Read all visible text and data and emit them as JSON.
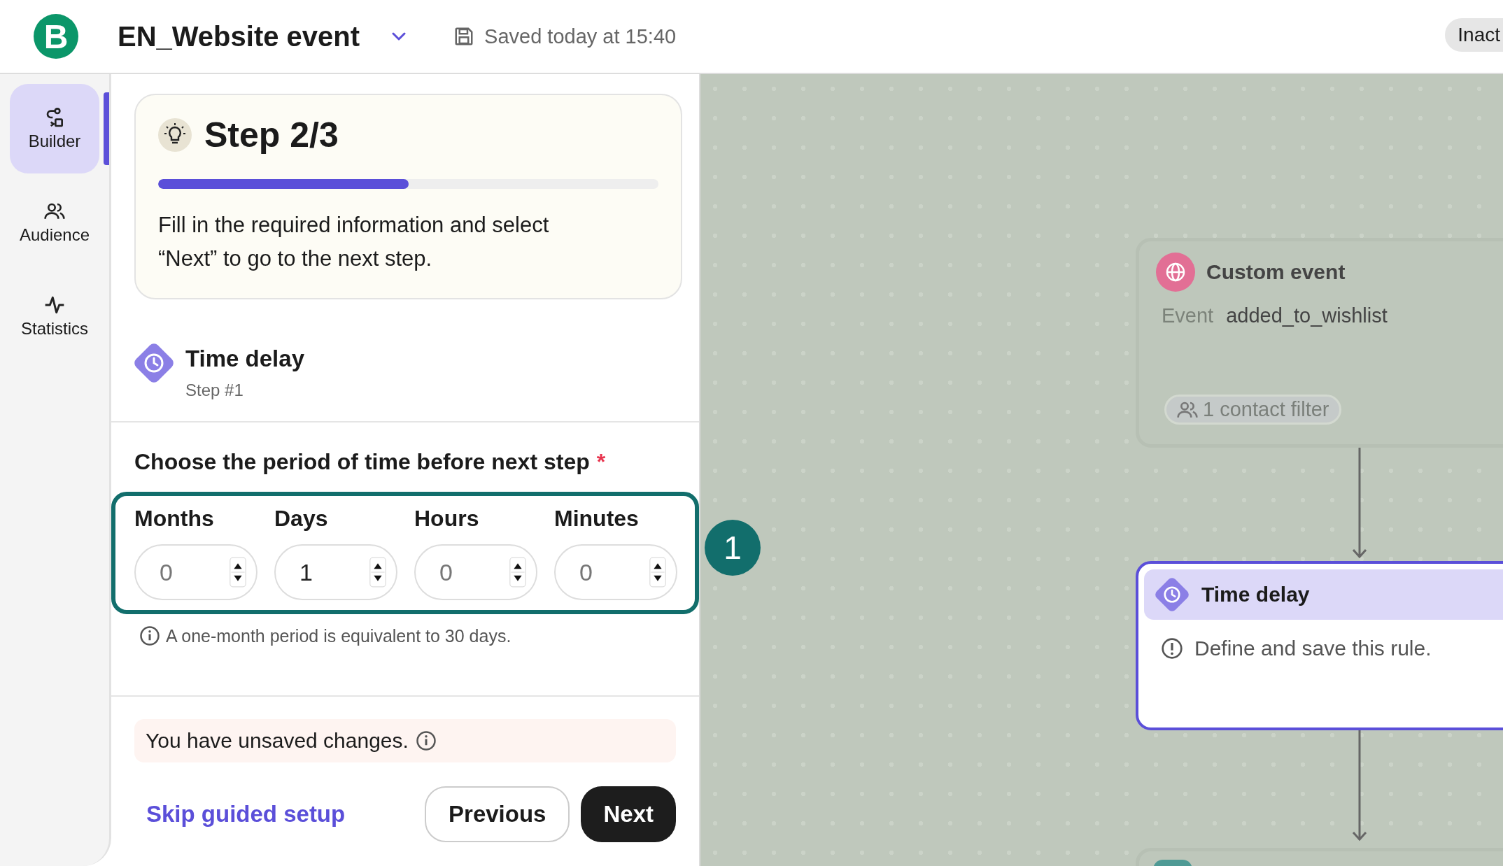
{
  "header": {
    "logo_letter": "B",
    "title": "EN_Website event",
    "save_status": "Saved today at 15:40",
    "status_badge": "Inact"
  },
  "nav": [
    {
      "label": "Builder",
      "selected": true
    },
    {
      "label": "Audience",
      "selected": false
    },
    {
      "label": "Statistics",
      "selected": false
    }
  ],
  "guide": {
    "title": "Step 2/3",
    "level": 0.5,
    "text": "Fill in the required information and select “Next” to go to the next step."
  },
  "step": {
    "title": "Time delay",
    "subtitle": "Step #1"
  },
  "period": {
    "label": "Choose the period of time before next step",
    "required": true,
    "required_mark": "*",
    "fields": [
      {
        "label": "Months",
        "placeholder": "0"
      },
      {
        "label": "Days",
        "value": "1"
      },
      {
        "label": "Hours",
        "placeholder": "0"
      },
      {
        "label": "Minutes",
        "placeholder": "0"
      }
    ],
    "hint": "A one-month period is equivalent to 30 days.",
    "callout": "1"
  },
  "unsaved": "You have unsaved changes.",
  "actions": {
    "skip": "Skip guided setup",
    "previous": "Previous",
    "next": "Next"
  },
  "canvas": {
    "nodes": [
      {
        "kind": "trigger",
        "selected": false,
        "title": "Custom event",
        "field_label": "Event",
        "field_value": "added_to_wishlist",
        "filter": "1 contact filter"
      },
      {
        "kind": "delay",
        "selected": true,
        "title": "Time delay",
        "warning": "Define and save this rule."
      },
      {
        "kind": "partial",
        "selected": false
      }
    ]
  }
}
